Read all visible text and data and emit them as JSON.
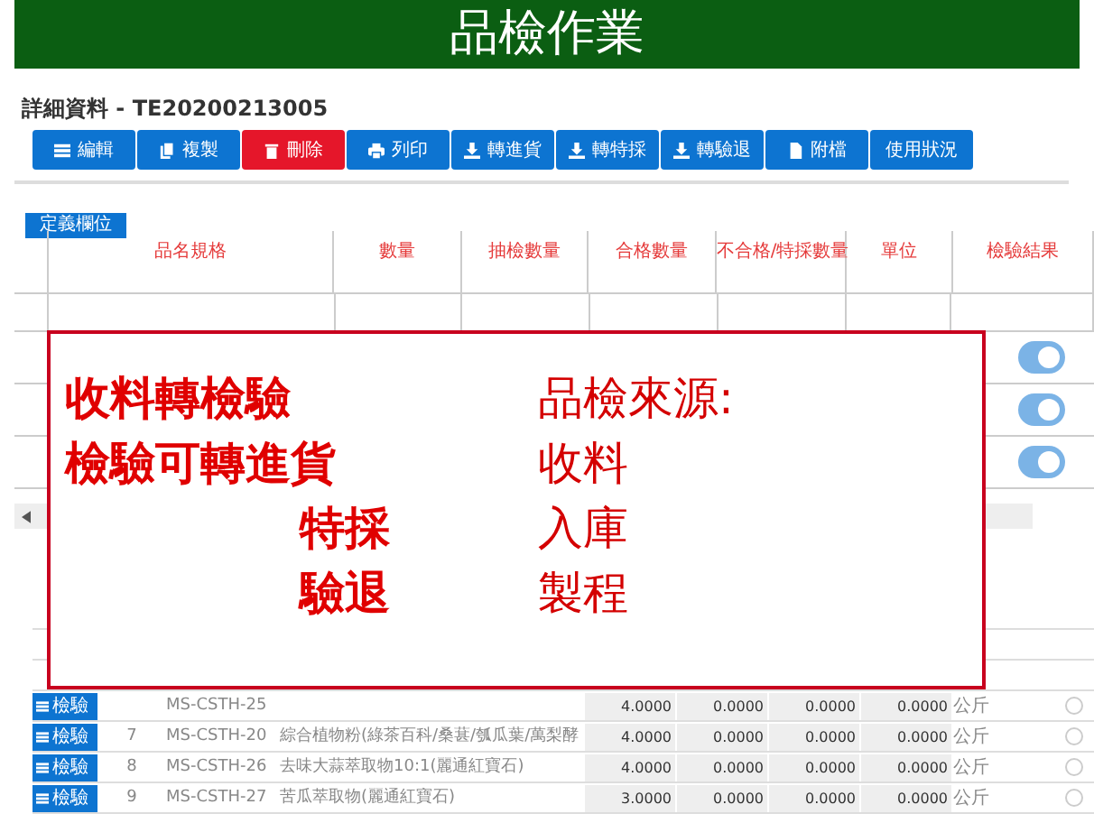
{
  "slide_title": "品檢作業",
  "detail": {
    "heading": "詳細資料 - TE20200213005",
    "toolbar": [
      {
        "label": "編輯",
        "kind": "primary"
      },
      {
        "label": "複製",
        "kind": "primary"
      },
      {
        "label": "刪除",
        "kind": "danger"
      },
      {
        "label": "列印",
        "kind": "primary"
      },
      {
        "label": "轉進貨",
        "kind": "primary"
      },
      {
        "label": "轉特採",
        "kind": "primary"
      },
      {
        "label": "轉驗退",
        "kind": "primary"
      },
      {
        "label": "附檔",
        "kind": "primary"
      },
      {
        "label": "使用狀況",
        "kind": "primary"
      }
    ],
    "define_columns_button": "定義欄位",
    "columns": [
      "品名規格",
      "數量",
      "抽檢數量",
      "合格數量",
      "不合格/特採數量",
      "單位",
      "檢驗結果"
    ],
    "toggles": [
      {
        "on": true
      },
      {
        "on": true
      },
      {
        "on": true
      }
    ]
  },
  "lower_table": {
    "rows": [
      {
        "button": "檢驗",
        "code": "MS-CSTH-25",
        "qty": "4.0000",
        "sample": "0.0000",
        "pass": "0.0000",
        "fail": "0.0000",
        "unit": "公斤",
        "checked": false
      },
      {
        "button": "檢驗",
        "no": "7",
        "code": "MS-CSTH-20",
        "name": "綜合植物粉(綠茶百科/桑葚/瓠瓜葉/萬梨酵",
        "qty": "4.0000",
        "sample": "0.0000",
        "pass": "0.0000",
        "fail": "0.0000",
        "unit": "公斤",
        "checked": false
      },
      {
        "button": "檢驗",
        "no": "8",
        "code": "MS-CSTH-26",
        "name": "去味大蒜萃取物10:1(麗通紅寶石)",
        "qty": "4.0000",
        "sample": "0.0000",
        "pass": "0.0000",
        "fail": "0.0000",
        "unit": "公斤",
        "checked": false
      },
      {
        "button": "檢驗",
        "no": "9",
        "code": "MS-CSTH-27",
        "name": "苦瓜萃取物(麗通紅寶石)",
        "qty": "3.0000",
        "sample": "0.0000",
        "pass": "0.0000",
        "fail": "0.0000",
        "unit": "公斤",
        "checked": false
      }
    ]
  },
  "callout": {
    "left_lines": [
      "收料轉檢驗",
      "檢驗可轉進貨",
      "特採",
      "驗退"
    ],
    "right_lines": [
      "品檢來源:",
      "收料",
      "入庫",
      "製程"
    ]
  }
}
